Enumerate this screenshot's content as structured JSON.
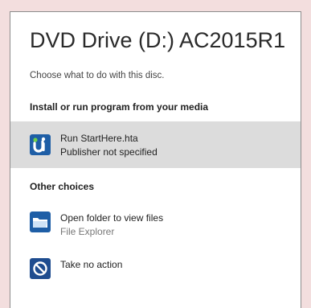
{
  "dialog": {
    "title": "DVD Drive (D:) AC2015R1",
    "subtitle": "Choose what to do with this disc."
  },
  "sections": {
    "media": "Install or run program from your media",
    "other": "Other choices"
  },
  "options": [
    {
      "label": "Run StartHere.hta",
      "sub": "Publisher not specified",
      "icon": "app-icon",
      "selected": true
    },
    {
      "label": "Open folder to view files",
      "sub": "File Explorer",
      "icon": "folder-icon",
      "selected": false
    },
    {
      "label": "Take no action",
      "sub": "",
      "icon": "no-action-icon",
      "selected": false
    }
  ],
  "colors": {
    "accent": "#1e5ea6",
    "selected_bg": "#dcdcdc",
    "page_bg": "#f3dede"
  }
}
